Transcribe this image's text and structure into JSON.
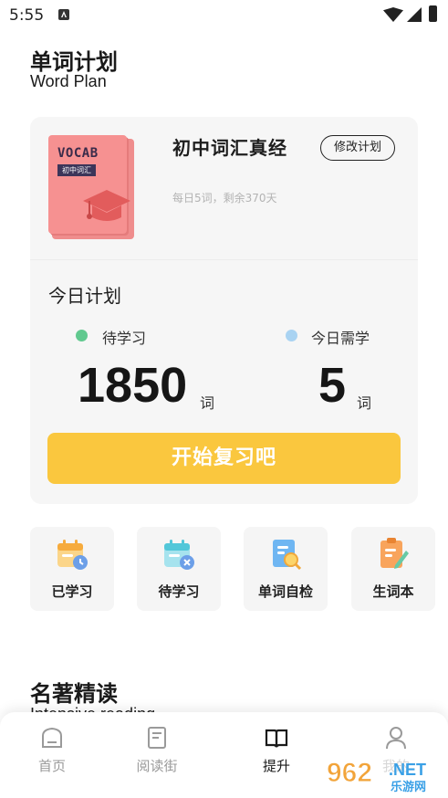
{
  "status_bar": {
    "time": "5:55"
  },
  "header": {
    "title": "单词计划",
    "subtitle": "Word Plan"
  },
  "plan": {
    "book_cover_title": "VOCAB",
    "book_cover_tag": "初中词汇",
    "book_name": "初中词汇真经",
    "edit_label": "修改计划",
    "meta": "每日5词，剩余370天",
    "today_title": "今日计划",
    "pending_label": "待学习",
    "pending_value": "1850",
    "today_need_label": "今日需学",
    "today_need_value": "5",
    "unit": "词",
    "start_button": "开始复习吧",
    "colors": {
      "pending_dot": "#61c98f",
      "today_dot": "#a9d3f2",
      "button": "#fac73e"
    }
  },
  "features": [
    {
      "label": "已学习",
      "icon": "calendar-clock-icon"
    },
    {
      "label": "待学习",
      "icon": "calendar-plus-icon"
    },
    {
      "label": "单词自检",
      "icon": "document-search-icon"
    },
    {
      "label": "生词本",
      "icon": "notebook-pen-icon"
    }
  ],
  "section": {
    "title": "名著精读",
    "subtitle": "Intensive reading"
  },
  "nav": [
    {
      "label": "首页",
      "icon": "home-icon"
    },
    {
      "label": "阅读街",
      "icon": "book-icon"
    },
    {
      "label": "提升",
      "icon": "open-book-icon"
    },
    {
      "label": "我的",
      "icon": "profile-icon"
    }
  ],
  "watermark": {
    "text_1": "962",
    "text_2": ".NET",
    "text_3": "乐游网"
  }
}
